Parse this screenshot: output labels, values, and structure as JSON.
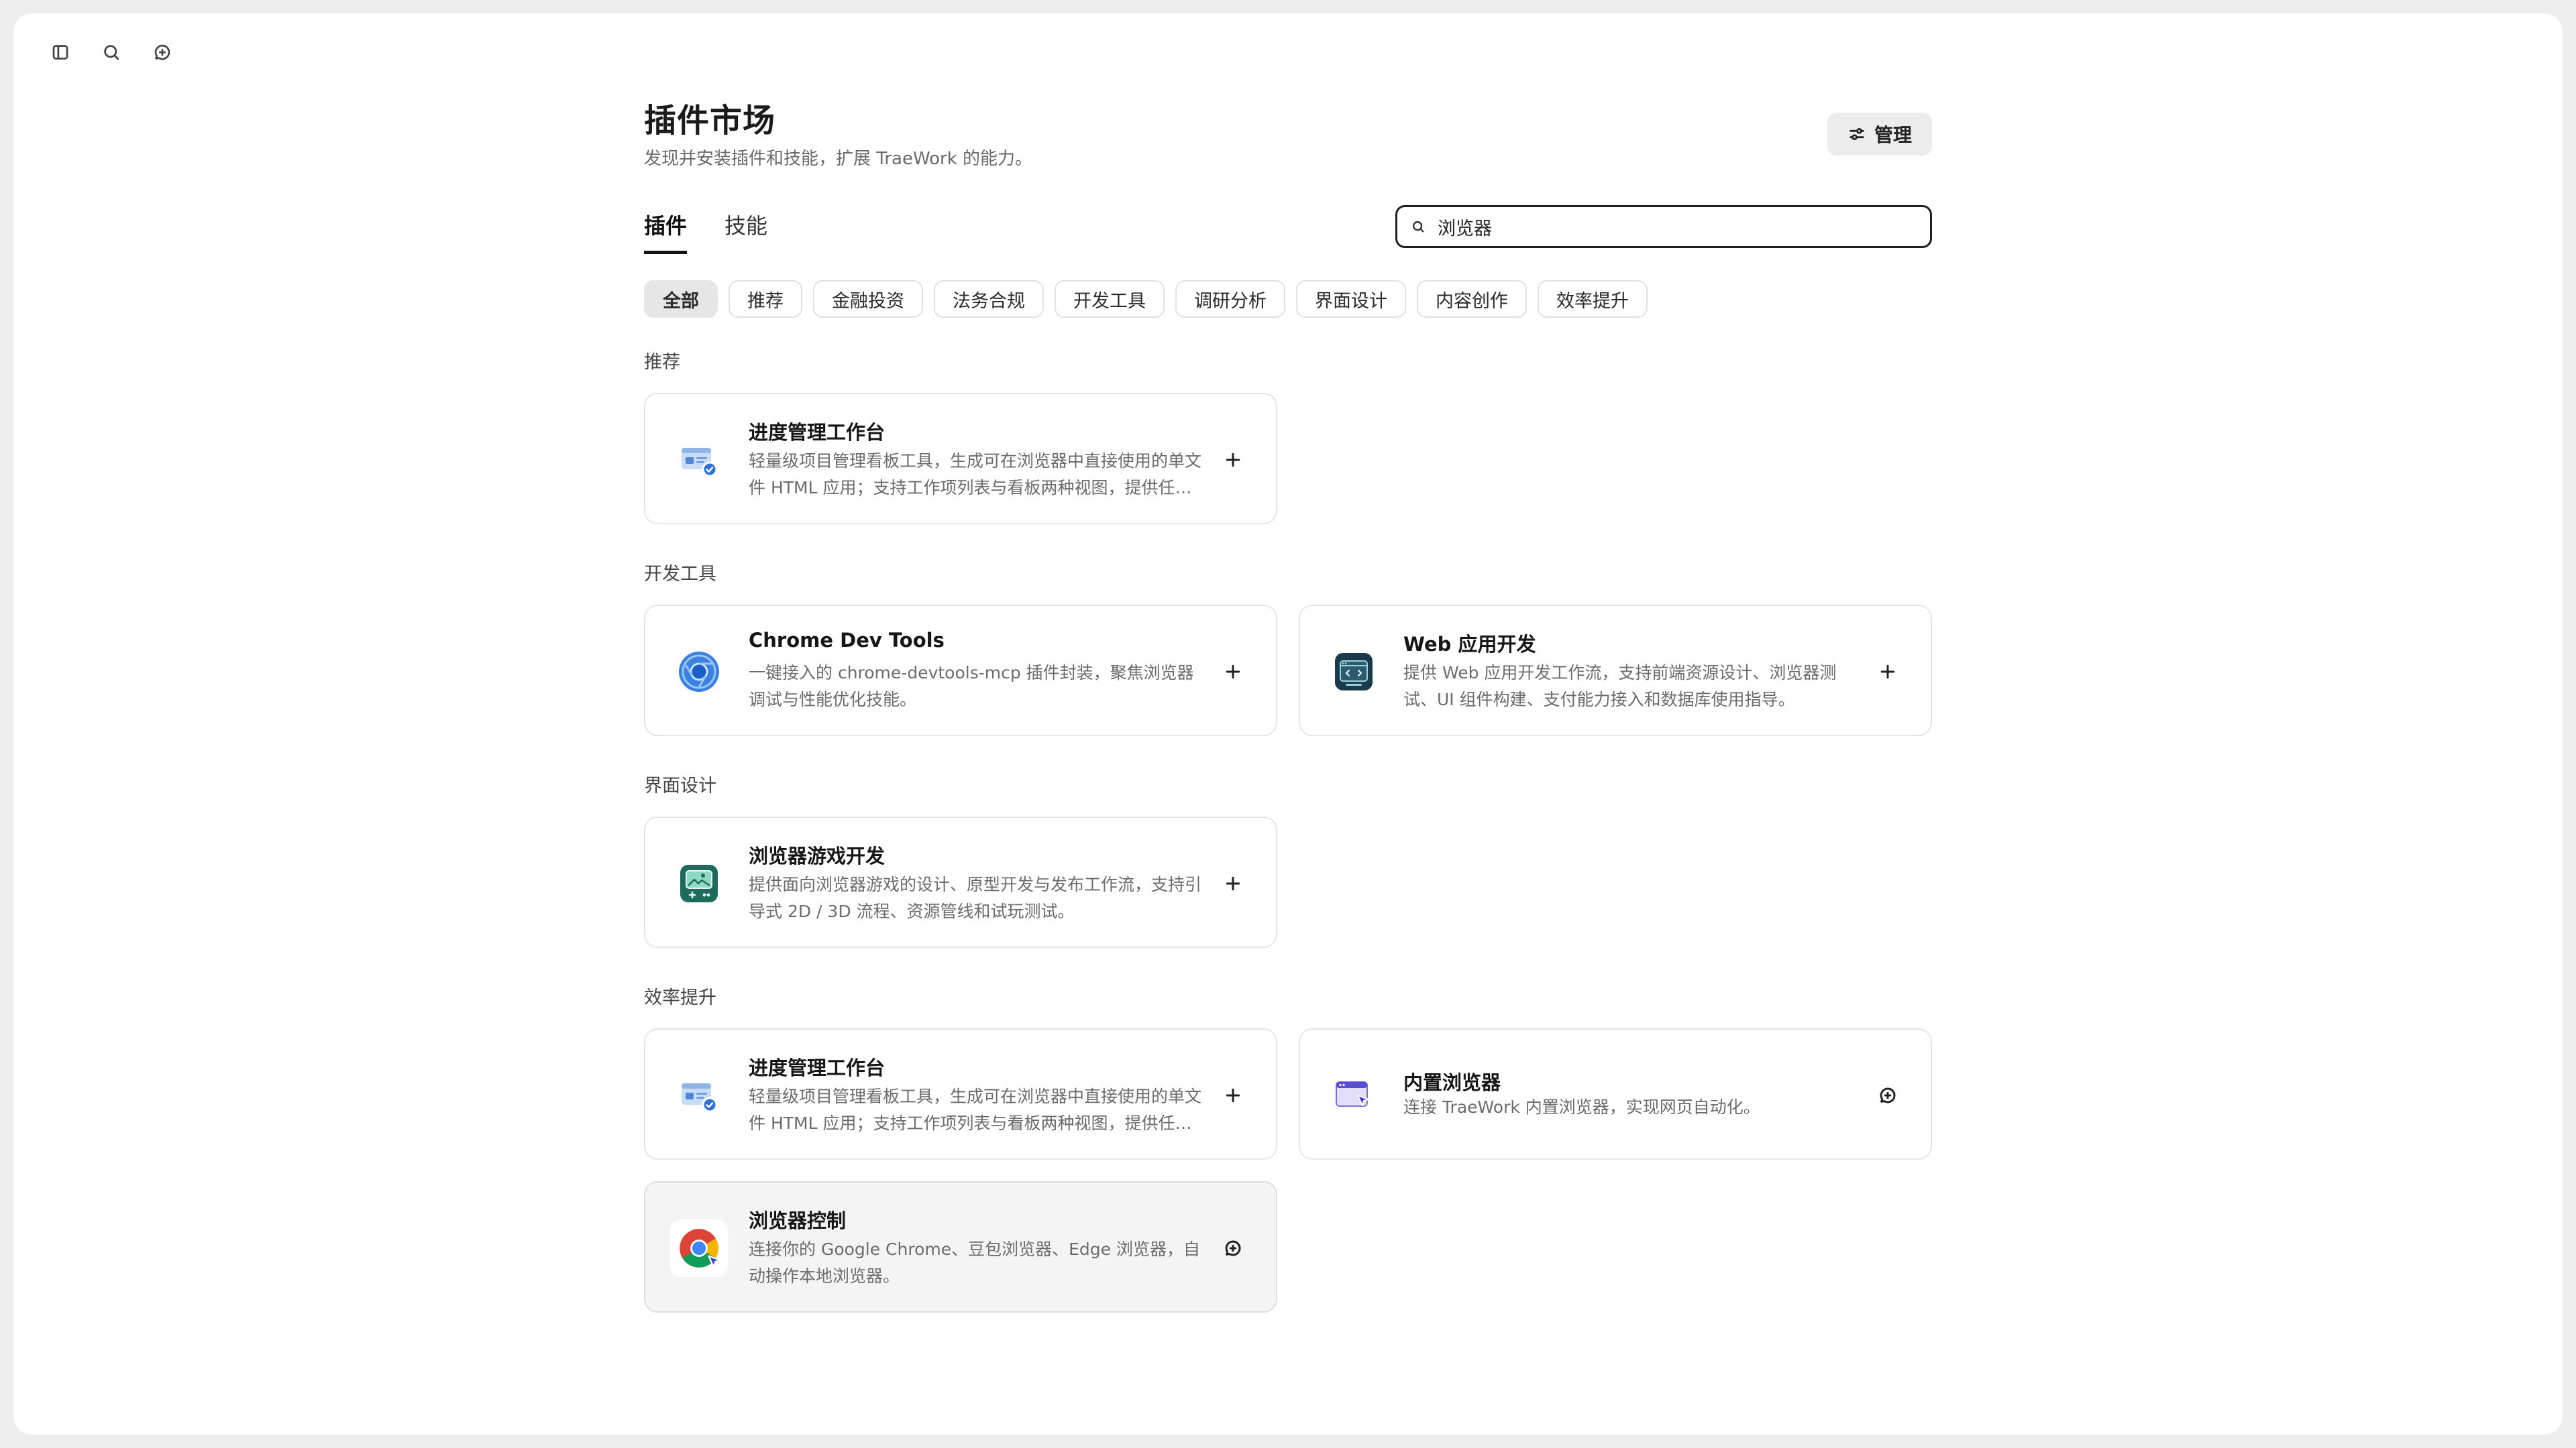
{
  "topbar": {
    "icons": [
      "sidebar-toggle-icon",
      "search-icon",
      "new-chat-icon"
    ]
  },
  "header": {
    "title": "插件市场",
    "subtitle": "发现并安装插件和技能，扩展 TraeWork 的能力。",
    "manage_label": "管理"
  },
  "tabs": [
    {
      "label": "插件",
      "active": true
    },
    {
      "label": "技能",
      "active": false
    }
  ],
  "search": {
    "value": "浏览器",
    "placeholder": ""
  },
  "chips": [
    {
      "label": "全部",
      "active": true
    },
    {
      "label": "推荐"
    },
    {
      "label": "金融投资"
    },
    {
      "label": "法务合规"
    },
    {
      "label": "开发工具"
    },
    {
      "label": "调研分析"
    },
    {
      "label": "界面设计"
    },
    {
      "label": "内容创作"
    },
    {
      "label": "效率提升"
    }
  ],
  "sections": {
    "recommended": {
      "label": "推荐"
    },
    "devtools": {
      "label": "开发工具"
    },
    "ui_design": {
      "label": "界面设计"
    },
    "efficiency": {
      "label": "效率提升"
    }
  },
  "cards": {
    "progress_1": {
      "title": "进度管理工作台",
      "desc": "轻量级项目管理看板工具，生成可在浏览器中直接使用的单文件 HTML 应用；支持工作项列表与看板两种视图，提供任务拖拽、状态流转等功能。",
      "icon": "kanban-board-icon",
      "action": "add"
    },
    "chrome_devtools": {
      "title": "Chrome Dev Tools",
      "desc": "一键接入的 chrome-devtools-mcp 插件封装，聚焦浏览器调试与性能优化技能。",
      "icon": "chrome-devtools-icon",
      "action": "add"
    },
    "web_app": {
      "title": "Web 应用开发",
      "desc": "提供 Web 应用开发工作流，支持前端资源设计、浏览器测试、UI 组件构建、支付能力接入和数据库使用指导。",
      "icon": "web-app-icon",
      "action": "add"
    },
    "browser_game": {
      "title": "浏览器游戏开发",
      "desc": "提供面向浏览器游戏的设计、原型开发与发布工作流，支持引导式 2D / 3D 流程、资源管线和试玩测试。",
      "icon": "game-console-icon",
      "action": "add"
    },
    "progress_2": {
      "title": "进度管理工作台",
      "desc": "轻量级项目管理看板工具，生成可在浏览器中直接使用的单文件 HTML 应用；支持工作项列表与看板两种视图，提供任务拖拽、状态流转等功能。",
      "icon": "kanban-board-icon",
      "action": "add"
    },
    "builtin_browser": {
      "title": "内置浏览器",
      "desc": "连接 TraeWork 内置浏览器，实现网页自动化。",
      "icon": "browser-window-icon",
      "action": "chat"
    },
    "browser_control": {
      "title": "浏览器控制",
      "desc": "连接你的 Google Chrome、豆包浏览器、Edge 浏览器，自动操作本地浏览器。",
      "icon": "chrome-icon",
      "action": "chat"
    }
  },
  "colors": {
    "accent_dark": "#1f1f1f",
    "chip_active_bg": "#e6e6e6",
    "card_border": "#e6e6e6",
    "chrome_blue": "#1a73e8",
    "game_teal": "#1e6b5c",
    "webapp_navy": "#1c3b4a"
  }
}
